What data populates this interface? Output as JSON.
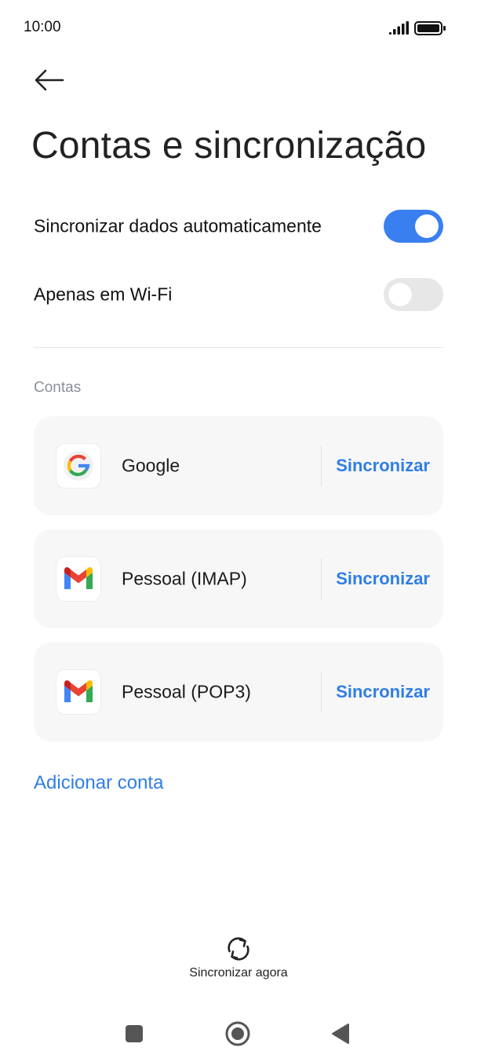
{
  "status_bar": {
    "time": "10:00",
    "icons": [
      "signal-icon",
      "battery-icon"
    ]
  },
  "header": {
    "back_icon": "arrow-left-icon",
    "title": "Contas e sincronização"
  },
  "settings": [
    {
      "label": "Sincronizar dados automaticamente",
      "enabled": true
    },
    {
      "label": "Apenas em Wi-Fi",
      "enabled": false
    }
  ],
  "accounts_section": {
    "header": "Contas",
    "items": [
      {
        "name": "Google",
        "icon": "google-icon",
        "action": "Sincronizar"
      },
      {
        "name": "Pessoal (IMAP)",
        "icon": "gmail-icon",
        "action": "Sincronizar"
      },
      {
        "name": "Pessoal (POP3)",
        "icon": "gmail-icon",
        "action": "Sincronizar"
      }
    ],
    "add_label": "Adicionar conta"
  },
  "footer": {
    "sync_now_label": "Sincronizar agora",
    "sync_now_icon": "refresh-icon"
  },
  "nav_bar": {
    "buttons": [
      "recents-square-icon",
      "home-circle-icon",
      "back-triangle-icon"
    ]
  },
  "colors": {
    "accent": "#2f7ee6",
    "toggle_on": "#3a7ff0",
    "toggle_off": "#e7e7e7",
    "card_bg": "#f7f7f7",
    "section_header": "#8a8f99"
  }
}
